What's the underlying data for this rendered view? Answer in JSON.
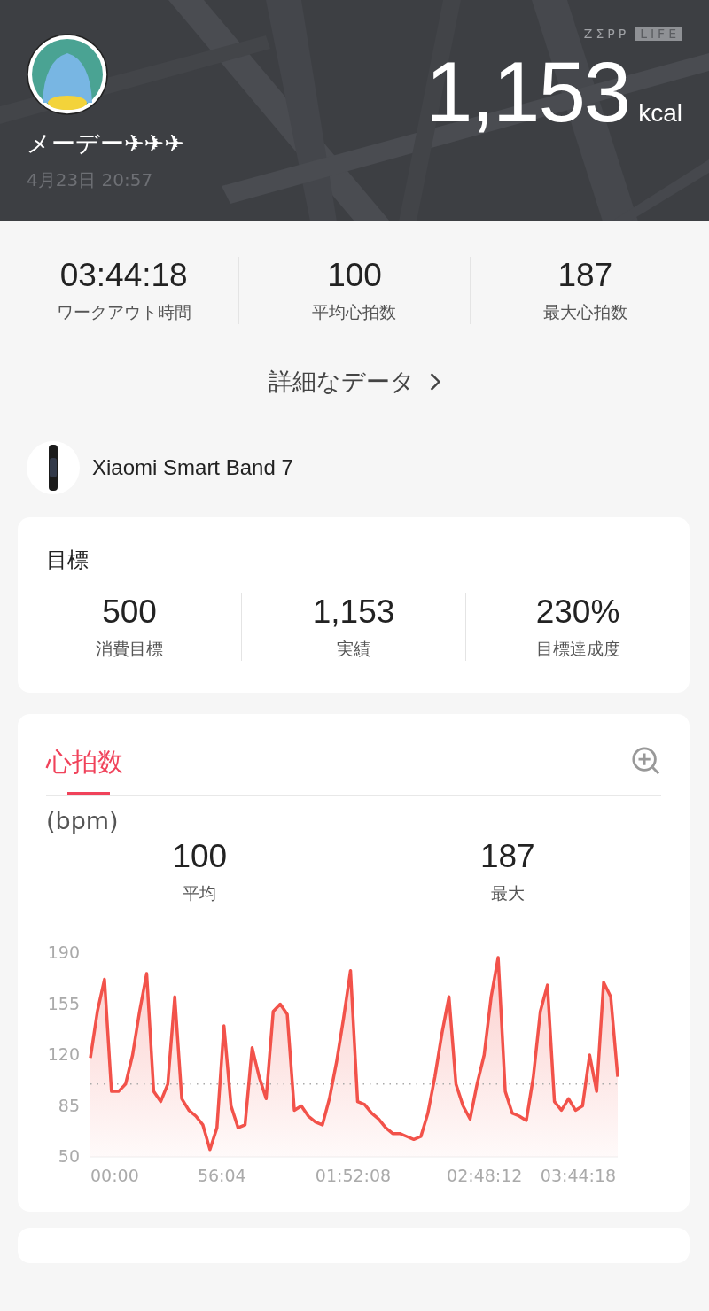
{
  "header": {
    "brand": [
      "ZΣPP",
      "LIFE"
    ],
    "user_name": "メーデー✈✈✈",
    "date": "4月23日 20:57",
    "calories": "1,153",
    "calories_unit": "kcal"
  },
  "summary": [
    {
      "value": "03:44:18",
      "label": "ワークアウト時間"
    },
    {
      "value": "100",
      "label": "平均心拍数"
    },
    {
      "value": "187",
      "label": "最大心拍数"
    }
  ],
  "details_link": "詳細なデータ",
  "device": {
    "name": "Xiaomi Smart Band 7"
  },
  "goal": {
    "title": "目標",
    "items": [
      {
        "value": "500",
        "label": "消費目標"
      },
      {
        "value": "1,153",
        "label": "実績"
      },
      {
        "value": "230%",
        "label": "目標達成度"
      }
    ]
  },
  "heart_rate": {
    "tabs": [
      {
        "label": "心拍数",
        "selected": true
      }
    ],
    "unit": "(bpm)",
    "stats": [
      {
        "value": "100",
        "label": "平均"
      },
      {
        "value": "187",
        "label": "最大"
      }
    ],
    "chart_data": {
      "type": "area",
      "xlim": [
        0,
        225
      ],
      "ylim": [
        50,
        190
      ],
      "yticks": [
        50,
        85,
        120,
        155,
        190
      ],
      "xticks": [
        {
          "value": 0,
          "label": "00:00"
        },
        {
          "value": 56.07,
          "label": "56:04"
        },
        {
          "value": 112.13,
          "label": "01:52:08"
        },
        {
          "value": 168.2,
          "label": "02:48:12"
        },
        {
          "value": 224.3,
          "label": "03:44:18"
        }
      ],
      "ref_lines": [
        {
          "axis": "y",
          "value": 100
        }
      ],
      "x": [
        0,
        3,
        6,
        9,
        12,
        15,
        18,
        21,
        24,
        27,
        30,
        33,
        36,
        39,
        42,
        45,
        48,
        51,
        54,
        57,
        60,
        63,
        66,
        69,
        72,
        75,
        78,
        81,
        84,
        87,
        90,
        93,
        96,
        99,
        102,
        105,
        108,
        111,
        114,
        117,
        120,
        123,
        126,
        129,
        132,
        135,
        138,
        141,
        144,
        147,
        150,
        153,
        156,
        159,
        162,
        165,
        168,
        171,
        174,
        177,
        180,
        183,
        186,
        189,
        192,
        195,
        198,
        201,
        204,
        207,
        210,
        213,
        216,
        219,
        222,
        225
      ],
      "series": [
        {
          "color": "#f2524a",
          "values": [
            118,
            150,
            172,
            95,
            95,
            100,
            120,
            150,
            176,
            95,
            88,
            100,
            160,
            90,
            82,
            78,
            72,
            55,
            70,
            140,
            85,
            70,
            72,
            125,
            105,
            90,
            150,
            155,
            148,
            82,
            85,
            78,
            74,
            72,
            90,
            115,
            145,
            178,
            88,
            86,
            80,
            76,
            70,
            66,
            66,
            64,
            62,
            64,
            80,
            105,
            135,
            160,
            100,
            85,
            76,
            100,
            120,
            160,
            187,
            95,
            80,
            78,
            75,
            105,
            150,
            168,
            88,
            82,
            90,
            82,
            85,
            120,
            95,
            170,
            160,
            105
          ]
        }
      ]
    }
  }
}
